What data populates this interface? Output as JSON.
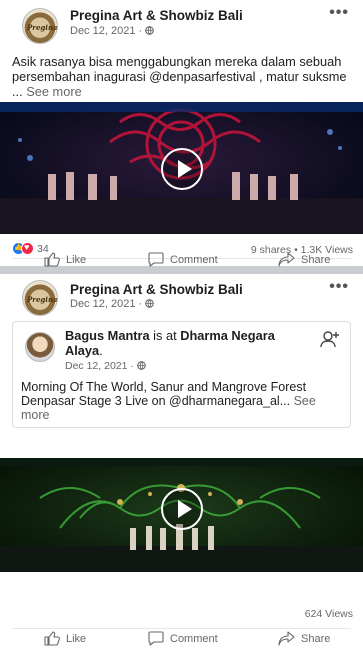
{
  "post1": {
    "page_name": "Pregina Art & Showbiz Bali",
    "date": "Dec 12, 2021 · ",
    "caption": "Asik rasanya bisa menggabungkan mereka dalam sebuah persembahan inagurasi @denpasarfestival , matur suksme ... ",
    "see_more": "See more",
    "reaction_count": "34",
    "shares_views": "9 shares • 1.3K Views"
  },
  "post2": {
    "page_name": "Pregina Art & Showbiz Bali",
    "date": "Dec 12, 2021 · ",
    "shared": {
      "author": "Bagus Mantra",
      "is_at": " is at ",
      "place": "Dharma Negara Alaya",
      "period": ".",
      "date": "Dec 12, 2021 · ",
      "caption": "Morning Of The World, Sanur and Mangrove Forest Denpasar Stage 3 Live on @dharmanegara_al... ",
      "see_more": "See more"
    },
    "views": "624 Views"
  },
  "actions": {
    "like": "Like",
    "comment": "Comment",
    "share": "Share"
  },
  "icons": {
    "avatar_logo_text": "Pregina",
    "more": "more-options-icon",
    "globe": "globe-icon",
    "play": "play-icon",
    "like": "thumbs-up-icon",
    "comment": "comment-bubble-icon",
    "share": "share-arrow-icon",
    "add_friend": "add-friend-icon"
  },
  "colors": {
    "like_blue": "#1877f2",
    "love_red": "#f0284a",
    "secondary_text": "#65676b"
  }
}
